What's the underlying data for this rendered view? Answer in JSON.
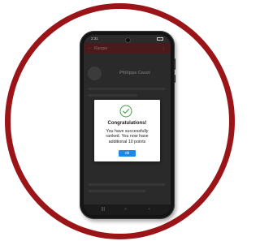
{
  "status_bar": {
    "time": "2:31"
  },
  "app_bar": {
    "back_icon": "arrow-back-icon",
    "title": "Ranger",
    "menu_icon": "more-icon"
  },
  "profile": {
    "name": "Philippe Cavet"
  },
  "dialog": {
    "icon": "check-circle-icon",
    "title": "Congratulations!",
    "message": "You have successfully ranked. You now have additional 10 points",
    "ok_label": "ok"
  },
  "nav_bar": {
    "items": [
      "|||",
      "○",
      "‹"
    ]
  },
  "colors": {
    "ring": "#9b1418",
    "accent": "#1e88e5",
    "success": "#43a047"
  }
}
